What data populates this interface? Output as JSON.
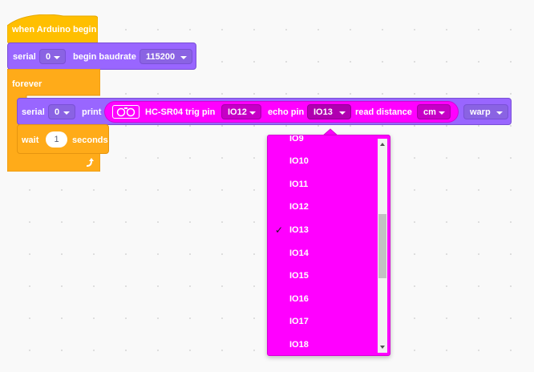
{
  "hat_block": {
    "label": "when Arduino begin"
  },
  "serial_begin_block": {
    "label_serial": "serial",
    "port_value": "0",
    "label_begin": "begin baudrate",
    "baud_value": "115200"
  },
  "forever_block": {
    "label": "forever",
    "loop_icon": "loop-arrow-icon"
  },
  "serial_print_block": {
    "label_serial": "serial",
    "port_value": "0",
    "label_print": "print",
    "mode_value": "warp"
  },
  "sensor_block": {
    "icon": "ultrasonic-sensor-icon",
    "label_trig": "HC-SR04 trig pin",
    "trig_value": "IO12",
    "label_echo": "echo pin",
    "echo_value": "IO13",
    "label_read": "read distance",
    "unit_value": "cm"
  },
  "wait_block": {
    "label_wait": "wait",
    "seconds_value": "1",
    "label_seconds": "seconds"
  },
  "pin_menu": {
    "partial_item": "IO9",
    "items": [
      "IO10",
      "IO11",
      "IO12",
      "IO13",
      "IO14",
      "IO15",
      "IO16",
      "IO17",
      "IO18"
    ],
    "selected": "IO13",
    "check_mark": "✓"
  },
  "colors": {
    "events": "#ffbf00",
    "control": "#ffab19",
    "serial": "#9966ff",
    "sensor": "#ff00ff",
    "canvas": "#f9f9f9"
  }
}
